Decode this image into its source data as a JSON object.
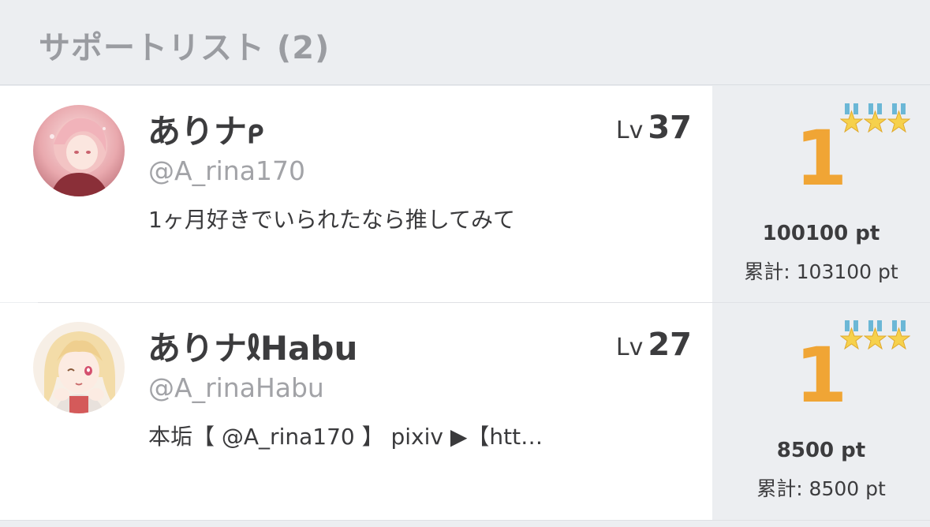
{
  "header": {
    "title": "サポートリスト (2)"
  },
  "colors": {
    "rank": "#f0a535",
    "panel": "#eceef1",
    "handle": "#a2a3a7",
    "text": "#3c3c3e"
  },
  "supporters": [
    {
      "name": "ありナ𐑁",
      "handle": "@A_rina170",
      "bio": "1ヶ月好きでいられたなら推してみて",
      "level_label": "Lv",
      "level": "37",
      "rank": "1",
      "stars": 3,
      "points": "100100 pt",
      "total": "累計: 103100 pt",
      "avatar_icon": "avatar-pink-hair-icon"
    },
    {
      "name": "ありナ𐑙Habu",
      "handle": "@A_rinaHabu",
      "bio": "本垢【 @A_rina170 】 pixiv ▶【htt…",
      "level_label": "Lv",
      "level": "27",
      "rank": "1",
      "stars": 3,
      "points": "8500 pt",
      "total": "累計: 8500 pt",
      "avatar_icon": "avatar-blonde-hair-icon"
    }
  ]
}
